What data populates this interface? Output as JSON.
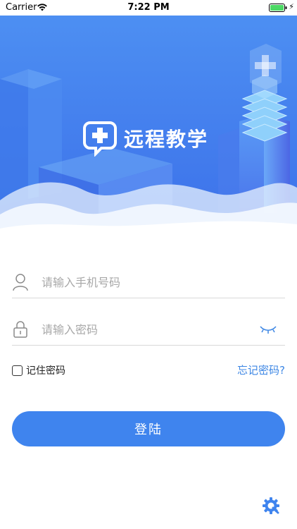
{
  "status_bar": {
    "carrier": "Carrier",
    "time": "7:22 PM"
  },
  "brand": {
    "title": "远程教学",
    "icon": "chat-plus-icon"
  },
  "form": {
    "phone_placeholder": "请输入手机号码",
    "password_placeholder": "请输入密码",
    "remember_label": "记住密码",
    "forgot_label": "忘记密码?",
    "login_label": "登陆"
  },
  "icons": {
    "phone_field": "user-icon",
    "password_field": "lock-icon",
    "password_toggle": "eye-closed-icon",
    "settings": "settings-gear-icon"
  },
  "colors": {
    "primary": "#3f84ee",
    "link": "#3c86e4",
    "hero_top": "#4d8ff2",
    "hero_bottom": "#3a66e8"
  }
}
